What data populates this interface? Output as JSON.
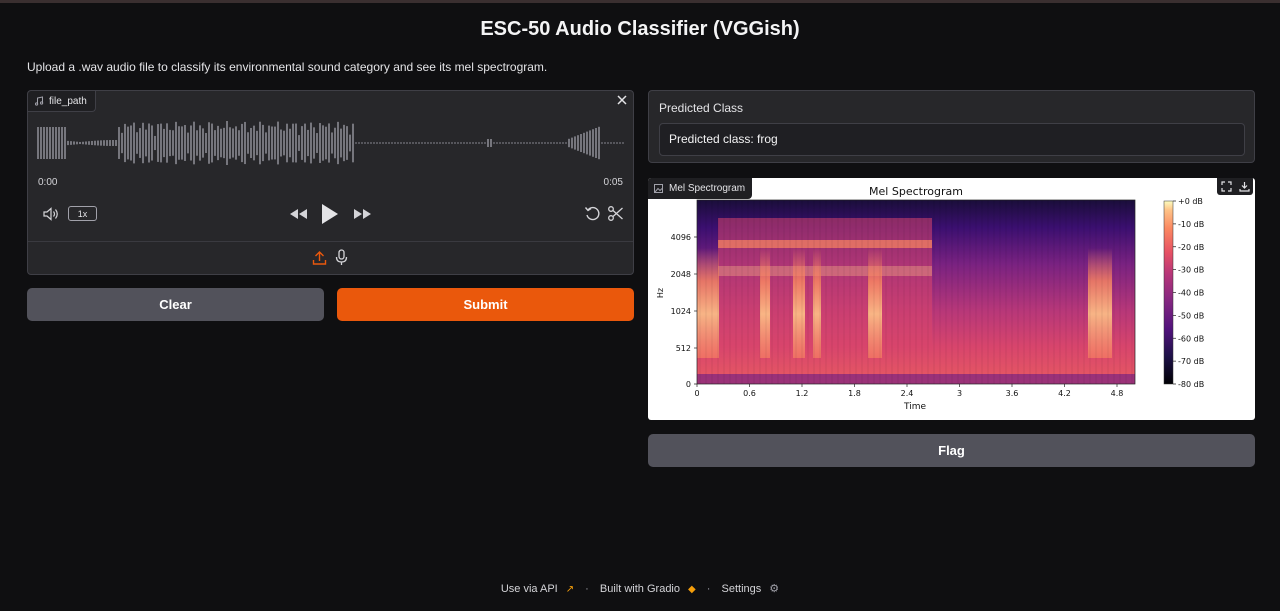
{
  "app": {
    "title": "ESC-50 Audio Classifier (VGGish)",
    "description": "Upload a .wav audio file to classify its environmental sound category and see its mel spectrogram."
  },
  "audio_input": {
    "label": "file_path",
    "time_start": "0:00",
    "time_end": "0:05",
    "speed": "1x",
    "icons": [
      "music-icon",
      "close-icon",
      "volume-icon",
      "rewind-icon",
      "play-icon",
      "fast-forward-icon",
      "reset-icon",
      "scissors-icon",
      "upload-icon",
      "microphone-icon"
    ]
  },
  "buttons": {
    "clear": "Clear",
    "submit": "Submit",
    "flag": "Flag"
  },
  "prediction": {
    "label": "Predicted Class",
    "value": "Predicted class: frog"
  },
  "spectrogram_panel": {
    "label": "Mel Spectrogram",
    "icons": [
      "image-icon",
      "fullscreen-icon",
      "download-icon"
    ]
  },
  "chart_data": {
    "type": "heatmap",
    "title": "Mel Spectrogram",
    "xlabel": "Time",
    "ylabel": "Hz",
    "x_ticks": [
      "0",
      "0.6",
      "1.2",
      "1.8",
      "2.4",
      "3",
      "3.6",
      "4.2",
      "4.8"
    ],
    "y_ticks": [
      "0",
      "512",
      "1024",
      "2048",
      "4096"
    ],
    "colorbar_ticks": [
      "+0 dB",
      "-10 dB",
      "-20 dB",
      "-30 dB",
      "-40 dB",
      "-50 dB",
      "-60 dB",
      "-70 dB",
      "-80 dB"
    ],
    "colormap": "magma",
    "xlim": [
      0,
      5
    ],
    "colorbar_range_db": [
      -80,
      0
    ]
  },
  "footer": {
    "api": "Use via API",
    "built": "Built with Gradio",
    "settings": "Settings"
  },
  "colors": {
    "accent": "#ea580c",
    "background": "#0f0f11",
    "panel": "#27272a",
    "secondary_button": "#52525b"
  }
}
